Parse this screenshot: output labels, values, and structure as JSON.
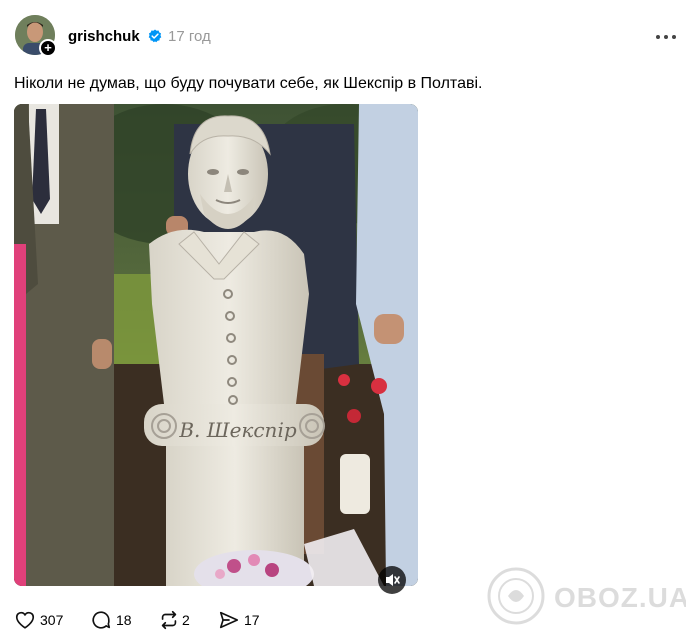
{
  "post": {
    "username": "grishchuk",
    "time": "17 год",
    "follow_symbol": "+",
    "caption": "Ніколи не думав, що буду почувати себе, як Шекспір в Полтаві.",
    "verified_color": "#0095f6"
  },
  "media": {
    "plaque_text": "В. Шекспір"
  },
  "actions": {
    "likes": "307",
    "comments": "18",
    "reposts": "2",
    "shares": "17"
  },
  "watermark": {
    "text": "OBOZ.UA"
  },
  "icons": [
    "more-icon",
    "heart-icon",
    "comment-icon",
    "repost-icon",
    "share-icon",
    "mute-icon",
    "verified-icon"
  ]
}
